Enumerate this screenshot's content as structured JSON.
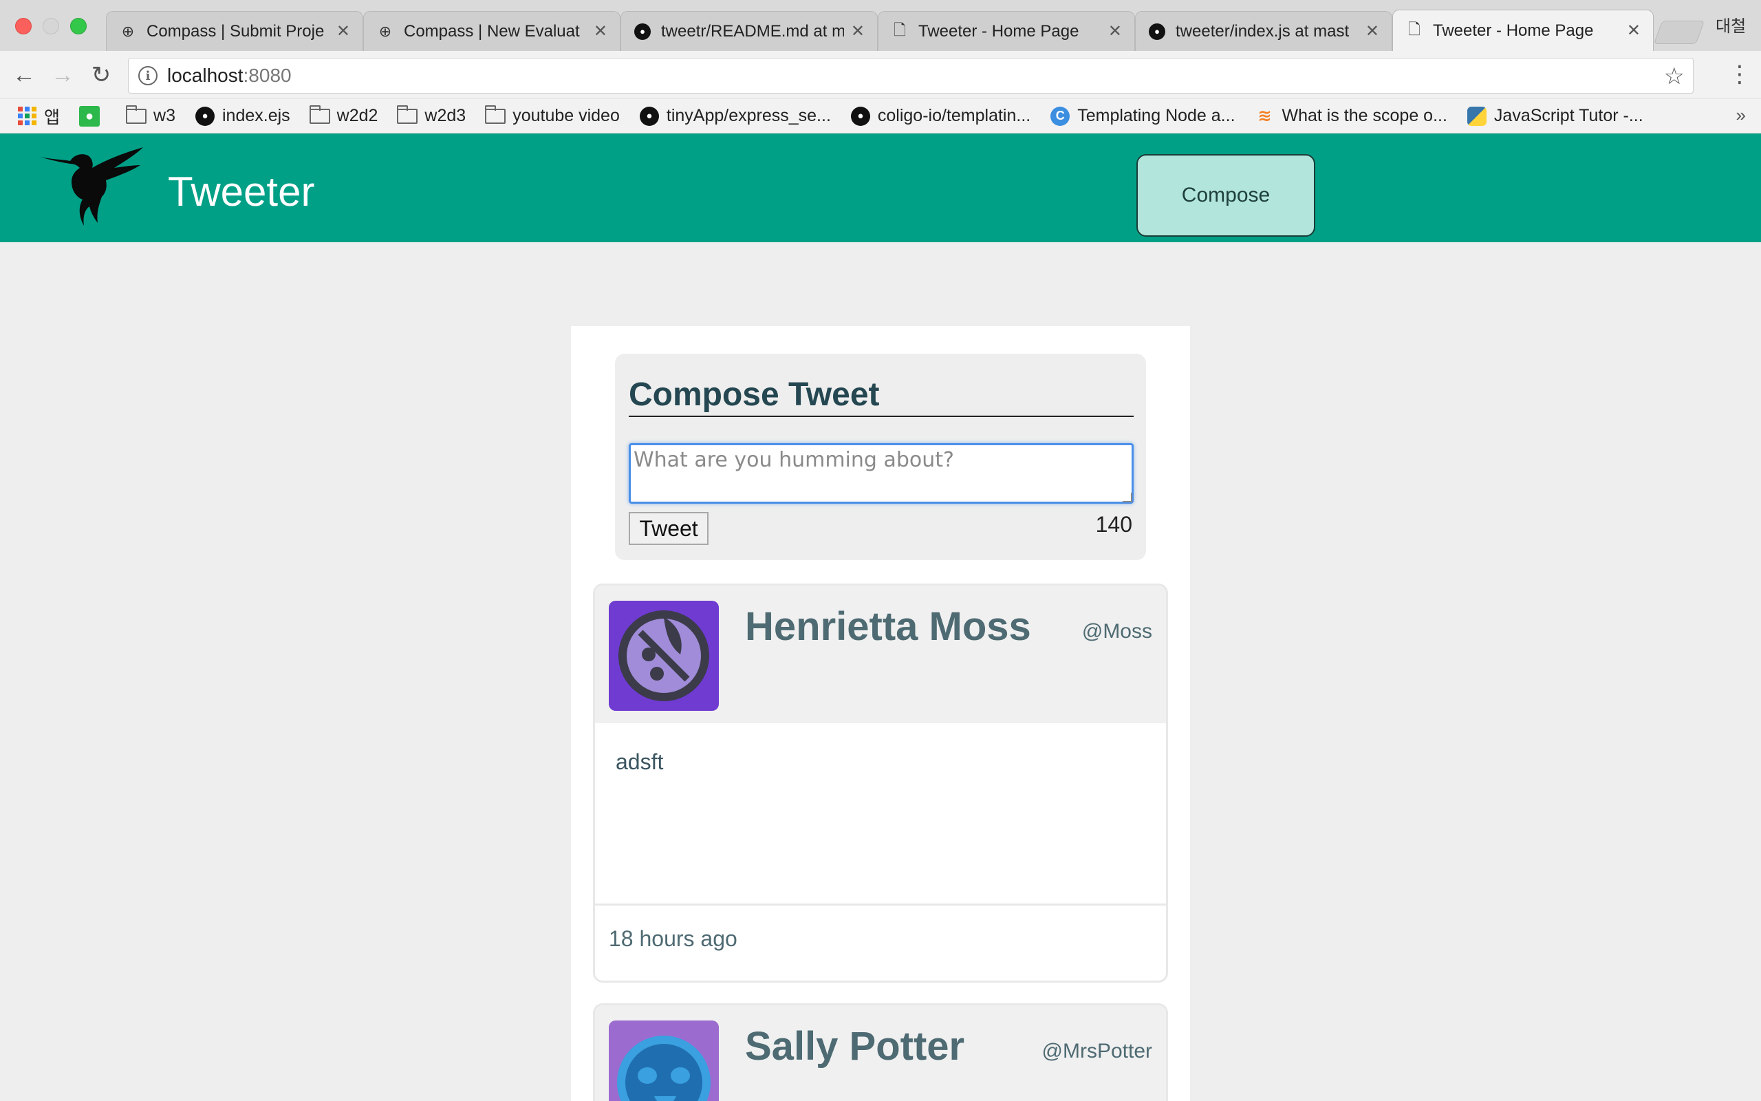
{
  "browser": {
    "tabs": [
      {
        "label": "Compass | Submit Proje",
        "icon": "compass-icon"
      },
      {
        "label": "Compass | New Evaluat",
        "icon": "compass-icon"
      },
      {
        "label": "tweetr/README.md at m",
        "icon": "github-icon"
      },
      {
        "label": "Tweeter - Home Page",
        "icon": "document-icon"
      },
      {
        "label": "tweeter/index.js at mast",
        "icon": "github-icon"
      },
      {
        "label": "Tweeter - Home Page",
        "icon": "document-icon"
      }
    ],
    "profile_name": "대철",
    "url_host": "localhost",
    "url_port": ":8080",
    "bookmarks": [
      {
        "label": "앱",
        "icon": "apps-icon"
      },
      {
        "label": "",
        "icon": "apple-icon"
      },
      {
        "label": "w3",
        "icon": "folder-icon"
      },
      {
        "label": "index.ejs",
        "icon": "github-icon"
      },
      {
        "label": "w2d2",
        "icon": "folder-icon"
      },
      {
        "label": "w2d3",
        "icon": "folder-icon"
      },
      {
        "label": "youtube video",
        "icon": "folder-icon"
      },
      {
        "label": "tinyApp/express_se...",
        "icon": "github-icon"
      },
      {
        "label": "coligo-io/templatin...",
        "icon": "github-icon"
      },
      {
        "label": "Templating Node a...",
        "icon": "c-icon"
      },
      {
        "label": "What is the scope o...",
        "icon": "stackoverflow-icon"
      },
      {
        "label": "JavaScript Tutor -...",
        "icon": "python-icon"
      }
    ],
    "bookmarks_more": "»"
  },
  "header": {
    "brand": "Tweeter",
    "compose_label": "Compose",
    "color": "#00a087"
  },
  "new_tweet": {
    "title": "Compose Tweet",
    "placeholder": "What are you humming about?",
    "button_label": "Tweet",
    "counter": "140"
  },
  "tweets": [
    {
      "name": "Henrietta Moss",
      "handle": "@Moss",
      "body": "adsft",
      "time": "18 hours ago",
      "avatar_color": "#6f3bd1"
    },
    {
      "name": "Sally Potter",
      "handle": "@MrsPotter",
      "avatar_color": "#9b6bd0"
    }
  ]
}
